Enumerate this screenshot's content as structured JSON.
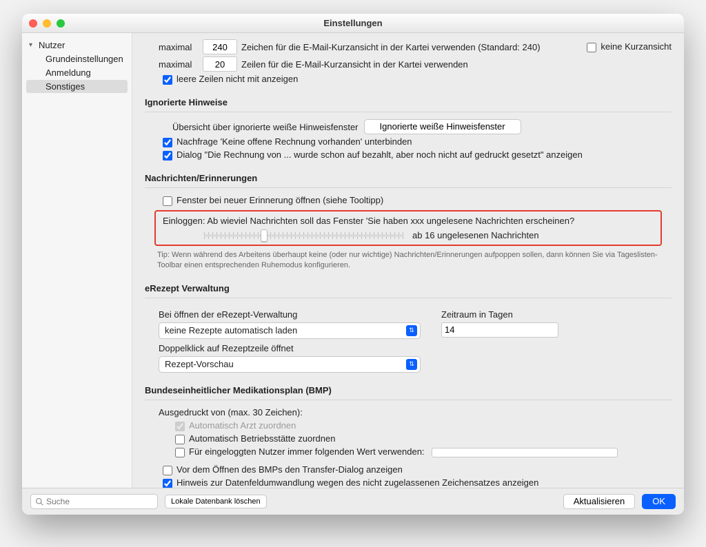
{
  "window": {
    "title": "Einstellungen"
  },
  "sidebar": {
    "root": "Nutzer",
    "items": [
      "Grundeinstellungen",
      "Anmeldung",
      "Sonstiges"
    ],
    "selected_index": 2
  },
  "email": {
    "max_chars_label": "maximal",
    "max_chars_value": "240",
    "max_chars_desc": "Zeichen für die E-Mail-Kurzansicht in der Kartei verwenden (Standard: 240)",
    "no_short_label": "keine Kurzansicht",
    "max_lines_label": "maximal",
    "max_lines_value": "20",
    "max_lines_desc": "Zeilen für die E-Mail-Kurzansicht in der Kartei verwenden",
    "hide_empty_label": "leere Zeilen nicht mit anzeigen"
  },
  "ignored": {
    "heading": "Ignorierte Hinweise",
    "overview_label": "Übersicht über ignorierte weiße Hinweisfenster",
    "button": "Ignorierte weiße Hinweisfenster",
    "check1": "Nachfrage 'Keine offene Rechnung vorhanden' unterbinden",
    "check2": "Dialog \"Die Rechnung von ... wurde schon auf bezahlt, aber noch nicht auf gedruckt gesetzt\" anzeigen"
  },
  "messages": {
    "heading": "Nachrichten/Erinnerungen",
    "check": "Fenster bei neuer Erinnerung öffnen (siehe Tooltipp)",
    "question": "Einloggen: Ab wieviel Nachrichten soll das Fenster 'Sie haben xxx ungelesene Nachrichten erscheinen?",
    "slider_label": "ab 16 ungelesenen Nachrichten",
    "slider_percent": 30,
    "tip": "Tip: Wenn während des Arbeitens überhaupt keine (oder nur wichtige) Nachrichten/Erinnerungen aufpoppen sollen, dann können Sie via Tageslisten-Toolbar einen entsprechenden Ruhemodus konfigurieren."
  },
  "erezept": {
    "heading": "eRezept Verwaltung",
    "open_label": "Bei öffnen der eRezept-Verwaltung",
    "open_value": "keine Rezepte automatisch laden",
    "period_label": "Zeitraum in Tagen",
    "period_value": "14",
    "dblclick_label": "Doppelklick auf Rezeptzeile öffnet",
    "dblclick_value": "Rezept-Vorschau"
  },
  "bmp": {
    "heading": "Bundeseinheitlicher Medikationsplan (BMP)",
    "printed_label": "Ausgedruckt von (max. 30 Zeichen):",
    "auto_doc": "Automatisch Arzt zuordnen",
    "auto_site": "Automatisch Betriebsstätte zuordnen",
    "logged_user": "Für eingeloggten Nutzer immer folgenden Wert verwenden:",
    "before_open": "Vor dem Öffnen des BMPs den Transfer-Dialog anzeigen",
    "charset_hint": "Hinweis zur Datenfeldumwandlung wegen des nicht zugelassenen Zeichensatzes anzeigen"
  },
  "footer": {
    "search_placeholder": "Suche",
    "delete_db": "Lokale Datenbank löschen",
    "refresh": "Aktualisieren",
    "ok": "OK"
  }
}
